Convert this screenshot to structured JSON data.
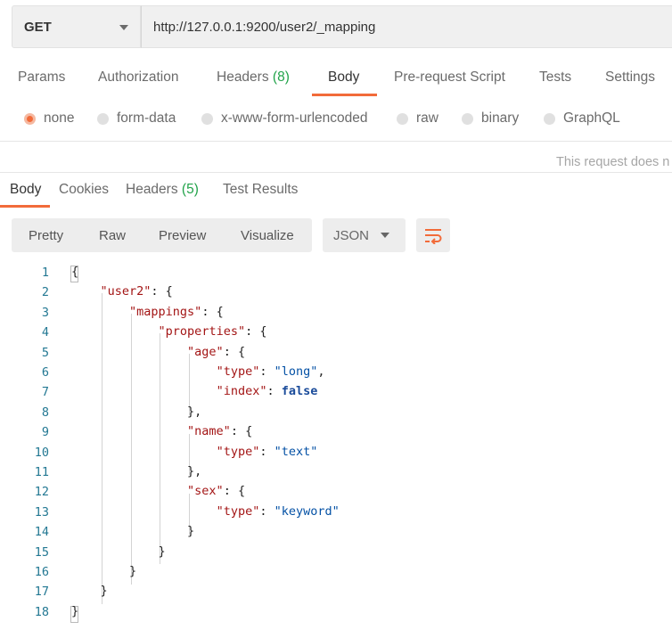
{
  "request": {
    "method": "GET",
    "url": "http://127.0.0.1:9200/user2/_mapping"
  },
  "request_tabs": [
    {
      "label": "Params"
    },
    {
      "label": "Authorization"
    },
    {
      "label": "Headers",
      "count": "(8)"
    },
    {
      "label": "Body"
    },
    {
      "label": "Pre-request Script"
    },
    {
      "label": "Tests"
    },
    {
      "label": "Settings"
    }
  ],
  "body_types": [
    {
      "label": "none",
      "checked": true
    },
    {
      "label": "form-data"
    },
    {
      "label": "x-www-form-urlencoded"
    },
    {
      "label": "raw"
    },
    {
      "label": "binary"
    },
    {
      "label": "GraphQL"
    }
  ],
  "info_text": "This request does n",
  "response_tabs": [
    {
      "label": "Body"
    },
    {
      "label": "Cookies"
    },
    {
      "label": "Headers",
      "count": "(5)"
    },
    {
      "label": "Test Results"
    }
  ],
  "view_modes": [
    "Pretty",
    "Raw",
    "Preview",
    "Visualize"
  ],
  "format": "JSON",
  "wrap_icon": "wrap-lines-icon",
  "colors": {
    "accent": "#f26b3a",
    "count_green": "#22a34a",
    "json_key": "#a31515",
    "json_string": "#0451a5",
    "json_bool": "#1a4b9a",
    "line_number": "#237893"
  },
  "code_lines": [
    {
      "n": "1",
      "text": "{"
    },
    {
      "n": "2",
      "text": "    \"user2\": {"
    },
    {
      "n": "3",
      "text": "        \"mappings\": {"
    },
    {
      "n": "4",
      "text": "            \"properties\": {"
    },
    {
      "n": "5",
      "text": "                \"age\": {"
    },
    {
      "n": "6",
      "text": "                    \"type\": \"long\","
    },
    {
      "n": "7",
      "text": "                    \"index\": false"
    },
    {
      "n": "8",
      "text": "                },"
    },
    {
      "n": "9",
      "text": "                \"name\": {"
    },
    {
      "n": "10",
      "text": "                    \"type\": \"text\""
    },
    {
      "n": "11",
      "text": "                },"
    },
    {
      "n": "12",
      "text": "                \"sex\": {"
    },
    {
      "n": "13",
      "text": "                    \"type\": \"keyword\""
    },
    {
      "n": "14",
      "text": "                }"
    },
    {
      "n": "15",
      "text": "            }"
    },
    {
      "n": "16",
      "text": "        }"
    },
    {
      "n": "17",
      "text": "    }"
    },
    {
      "n": "18",
      "text": "}"
    }
  ]
}
